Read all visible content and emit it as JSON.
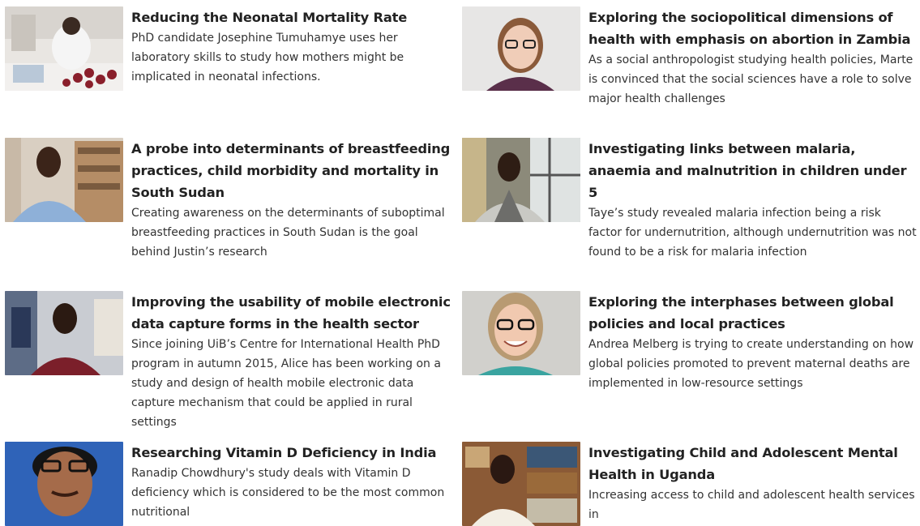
{
  "articles": [
    {
      "title": "Reducing the Neonatal Mortality Rate",
      "summary": "PhD candidate Josephine Tumuhamye uses her laboratory skills to study how mothers might be implicated in neonatal infections.",
      "image": "researcher-in-lab-photo"
    },
    {
      "title": "Exploring the sociopolitical dimensions of health with emphasis on abortion in Zambia",
      "summary": "As a social anthropologist studying health policies, Marte is convinced that the social sciences have a role to solve major health challenges",
      "image": "woman-portrait-photo"
    },
    {
      "title": "A probe into determinants of breastfeeding practices, child morbidity and mortality in South Sudan",
      "summary": "Creating awareness on the determinants of suboptimal breastfeeding practices in South Sudan is the goal behind Justin’s research",
      "image": "man-in-office-photo"
    },
    {
      "title": "Investigating links between malaria, anaemia and malnutrition in children under 5",
      "summary": "Taye’s study revealed malaria infection being a risk factor for undernutrition, although undernutrition was not found to be a risk for malaria infection",
      "image": "man-by-window-photo"
    },
    {
      "title": "Improving the usability of mobile electronic data capture forms in the health sector",
      "summary": "Since joining UiB’s Centre for International Health PhD program in autumn 2015, Alice has been working on a study and design of health mobile electronic data capture mechanism that could be applied in rural settings",
      "image": "woman-in-office-photo"
    },
    {
      "title": "Exploring the interphases between global policies and local practices",
      "summary": "Andrea Melberg is trying to create understanding on how global policies promoted to prevent maternal deaths are implemented in low-resource settings",
      "image": "smiling-woman-portrait-photo"
    },
    {
      "title": "Researching Vitamin D Deficiency in India",
      "summary": "Ranadip Chowdhury's study deals with Vitamin D deficiency which is considered to be the most common nutritional",
      "image": "man-with-glasses-portrait-photo"
    },
    {
      "title": "Investigating Child and Adolescent Mental Health in Uganda",
      "summary": "Increasing access to child and adolescent health services in",
      "image": "woman-with-bookshelf-photo"
    }
  ]
}
